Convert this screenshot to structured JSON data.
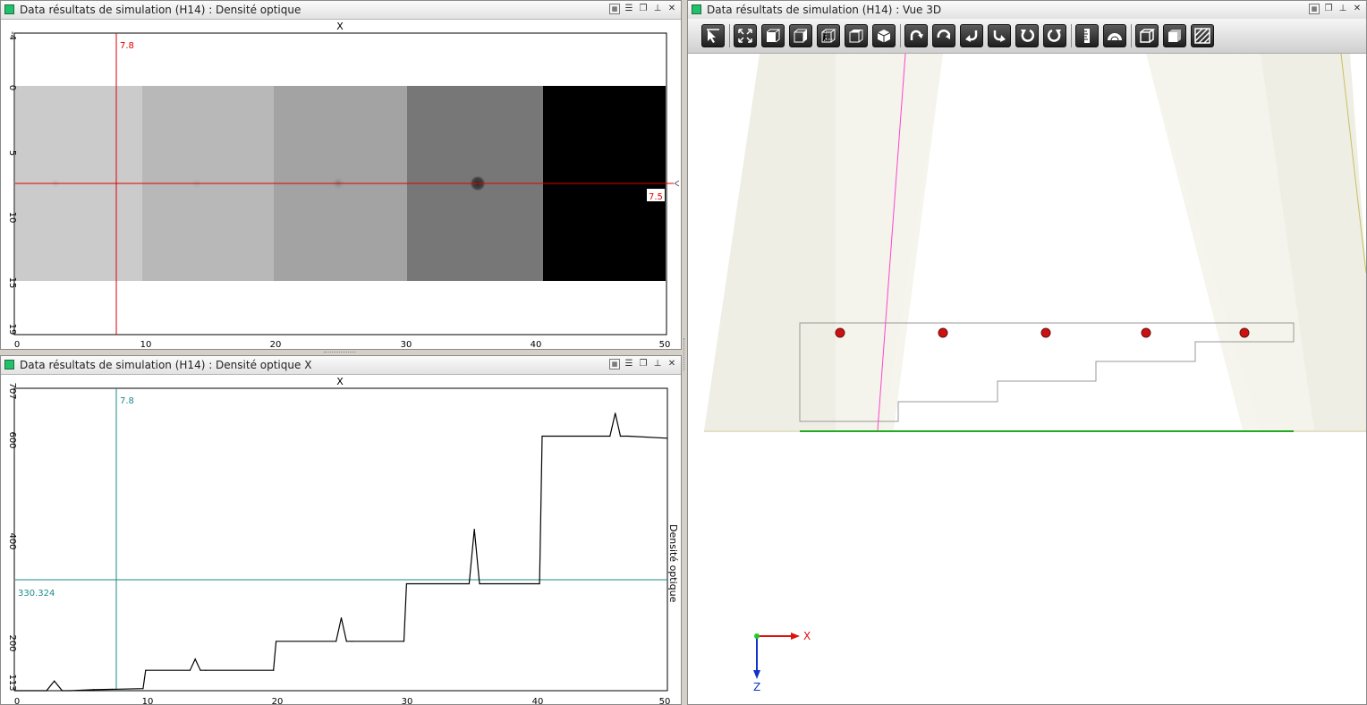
{
  "windows": {
    "density": {
      "title": "Data résultats de simulation (H14) : Densité optique",
      "x_axis_title": "X",
      "x_ticks": [
        "0",
        "10",
        "20",
        "30",
        "40",
        "50"
      ],
      "y_ticks": [
        "-4",
        "0",
        "5",
        "10",
        "15",
        "19"
      ],
      "cursor_x_value": "7.8",
      "cursor_y_value": "7.5"
    },
    "profile": {
      "title": "Data résultats de simulation (H14) : Densité optique X",
      "x_axis_title": "X",
      "y_axis_title": "Densité optique",
      "x_ticks": [
        "0",
        "10",
        "20",
        "30",
        "40",
        "50"
      ],
      "y_ticks": [
        "113",
        "200",
        "400",
        "600",
        "707"
      ],
      "cursor_x_value": "7.8",
      "cursor_y_value": "330.324"
    },
    "view3d": {
      "title": "Data résultats de simulation (H14) : Vue 3D",
      "axis_x_label": "X",
      "axis_z_label": "Z",
      "toolbar_icons": [
        "pointer-icon",
        "fit-view-icon",
        "view-front-icon",
        "view-left-icon",
        "view-top-icon",
        "view-back-icon",
        "view-iso-icon",
        "rotate-up-icon",
        "rotate-down-icon",
        "rotate-left-icon",
        "rotate-right-icon",
        "rotate-ccw-icon",
        "rotate-cw-icon",
        "ruler-icon",
        "protractor-icon",
        "wireframe-icon",
        "solid-icon",
        "hatch-icon"
      ]
    }
  },
  "window_controls": [
    "options-icon",
    "database-icon",
    "restore-icon",
    "pin-icon",
    "close-icon"
  ],
  "colors": {
    "density_cursor": "#dd0000",
    "profile_cursor": "#1f8a8a",
    "marker": "#cc1111",
    "beam_line": "#ff44cc",
    "icon_green": "#22c06a"
  },
  "chart_data": {
    "type": "line",
    "title": "",
    "xlabel": "X",
    "ylabel": "Densité optique",
    "xlim": [
      0,
      50
    ],
    "ylim": [
      113,
      707
    ],
    "x": [
      0,
      2.4,
      3.0,
      3.6,
      4.2,
      6,
      9.8,
      10,
      13.4,
      13.8,
      14.2,
      14.6,
      19.8,
      20,
      24.6,
      25,
      25.4,
      25.8,
      29.8,
      30,
      34.8,
      35.2,
      35.6,
      36,
      40.2,
      40.4,
      45.6,
      46,
      46.4,
      47,
      50
    ],
    "values": [
      113,
      113,
      132,
      113,
      113,
      115,
      117,
      153,
      153,
      175,
      153,
      153,
      153,
      210,
      210,
      256,
      210,
      210,
      210,
      323,
      323,
      430,
      323,
      323,
      323,
      613,
      613,
      658,
      613,
      613,
      609
    ]
  }
}
